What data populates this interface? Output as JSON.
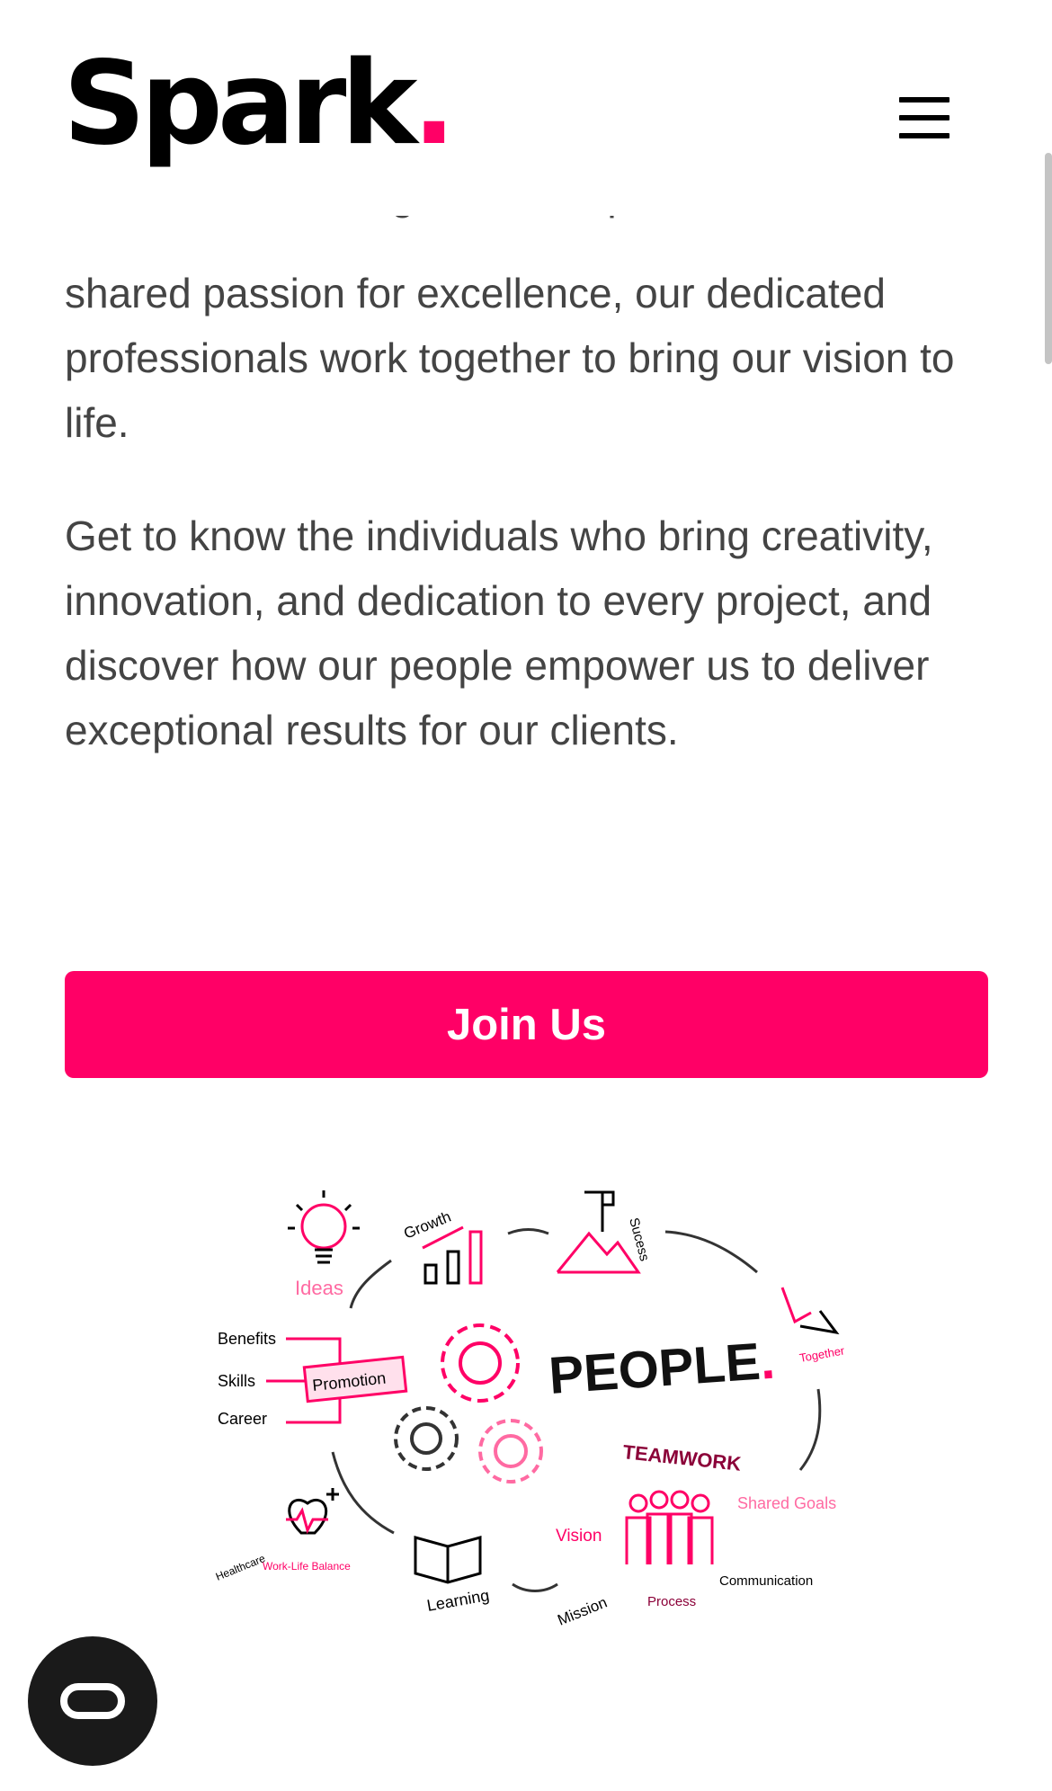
{
  "header": {
    "logo_text": "Spark",
    "logo_dot": ".",
    "menu_icon": "hamburger-menu-icon"
  },
  "content": {
    "clipped_line": "With diverse backgrounds, expertise, and a",
    "paragraph_1": "shared passion for excellence, our dedicated professionals work together to bring our vision to life.",
    "paragraph_2": "Get to know the individuals who bring creativity, innovation, and dedication to every project, and discover how our people empower us to deliver exceptional results for our clients."
  },
  "cta": {
    "label": "Join Us"
  },
  "illustration": {
    "center_title": "PEOPLE",
    "center_dot": ".",
    "labels": {
      "ideas": "Ideas",
      "growth": "Growth",
      "success": "Sucess",
      "together": "Together",
      "benefits": "Benefits",
      "skills": "Skills",
      "career": "Career",
      "promotion": "Promotion",
      "teamwork": "TEAMWORK",
      "shared_goals": "Shared Goals",
      "vision": "Vision",
      "healthcare": "Healthcare",
      "work_life_balance": "Work-Life Balance",
      "learning": "Learning",
      "mission": "Mission",
      "process": "Process",
      "communication": "Communication"
    }
  },
  "chat_widget": {
    "icon": "chat-widget-icon"
  },
  "colors": {
    "accent": "#ff0066",
    "text": "#444444",
    "dark": "#000000"
  }
}
